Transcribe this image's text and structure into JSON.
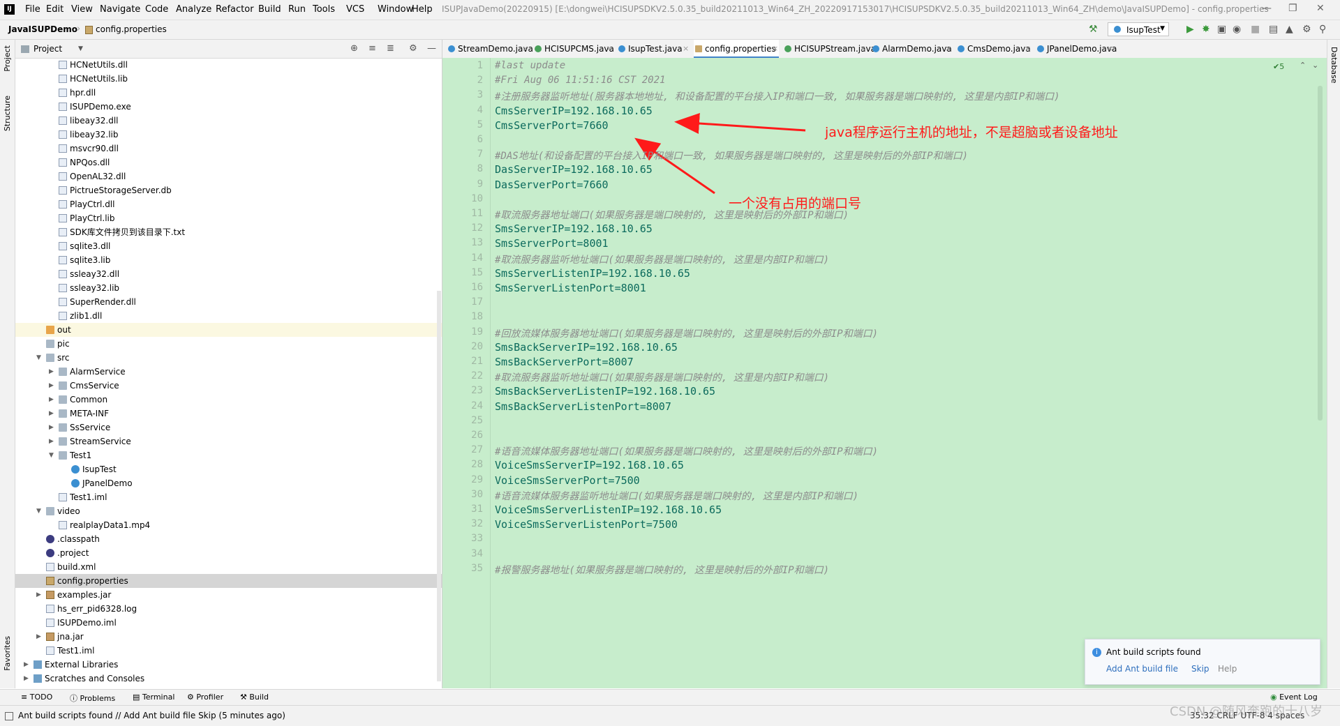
{
  "app": {
    "logo_text": "IJ",
    "window_title": "ISUPJavaDemo(20220915) [E:\\dongwei\\HCISUPSDKV2.5.0.35_build20211013_Win64_ZH_20220917153017\\HCISUPSDKV2.5.0.35_build20211013_Win64_ZH\\demo\\JavaISUPDemo] - config.properties"
  },
  "menu": [
    "File",
    "Edit",
    "View",
    "Navigate",
    "Code",
    "Analyze",
    "Refactor",
    "Build",
    "Run",
    "Tools",
    "VCS",
    "Window",
    "Help"
  ],
  "navbar": {
    "project": "JavaISUPDemo",
    "file": "config.properties",
    "run_config": "IsupTest"
  },
  "left_strip": [
    "Project",
    "Structure",
    "Favorites"
  ],
  "right_strip": [
    "Database"
  ],
  "project_panel": {
    "title": "Project",
    "tree": [
      {
        "label": "HCNetUtils.dll",
        "indent": 2,
        "icon": "file"
      },
      {
        "label": "HCNetUtils.lib",
        "indent": 2,
        "icon": "file"
      },
      {
        "label": "hpr.dll",
        "indent": 2,
        "icon": "file"
      },
      {
        "label": "ISUPDemo.exe",
        "indent": 2,
        "icon": "file"
      },
      {
        "label": "libeay32.dll",
        "indent": 2,
        "icon": "file"
      },
      {
        "label": "libeay32.lib",
        "indent": 2,
        "icon": "file"
      },
      {
        "label": "msvcr90.dll",
        "indent": 2,
        "icon": "file"
      },
      {
        "label": "NPQos.dll",
        "indent": 2,
        "icon": "file"
      },
      {
        "label": "OpenAL32.dll",
        "indent": 2,
        "icon": "file"
      },
      {
        "label": "PictrueStorageServer.db",
        "indent": 2,
        "icon": "file"
      },
      {
        "label": "PlayCtrl.dll",
        "indent": 2,
        "icon": "file"
      },
      {
        "label": "PlayCtrl.lib",
        "indent": 2,
        "icon": "file"
      },
      {
        "label": "SDK库文件拷贝到该目录下.txt",
        "indent": 2,
        "icon": "file"
      },
      {
        "label": "sqlite3.dll",
        "indent": 2,
        "icon": "file"
      },
      {
        "label": "sqlite3.lib",
        "indent": 2,
        "icon": "file"
      },
      {
        "label": "ssleay32.dll",
        "indent": 2,
        "icon": "file"
      },
      {
        "label": "ssleay32.lib",
        "indent": 2,
        "icon": "file"
      },
      {
        "label": "SuperRender.dll",
        "indent": 2,
        "icon": "file"
      },
      {
        "label": "zlib1.dll",
        "indent": 2,
        "icon": "file"
      },
      {
        "label": "out",
        "indent": 1,
        "icon": "folder-o",
        "hl": true
      },
      {
        "label": "pic",
        "indent": 1,
        "icon": "folder"
      },
      {
        "label": "src",
        "indent": 1,
        "icon": "folder",
        "arrow": "down"
      },
      {
        "label": "AlarmService",
        "indent": 2,
        "icon": "folder",
        "arrow": "right"
      },
      {
        "label": "CmsService",
        "indent": 2,
        "icon": "folder",
        "arrow": "right"
      },
      {
        "label": "Common",
        "indent": 2,
        "icon": "folder",
        "arrow": "right"
      },
      {
        "label": "META-INF",
        "indent": 2,
        "icon": "folder",
        "arrow": "right"
      },
      {
        "label": "SsService",
        "indent": 2,
        "icon": "folder",
        "arrow": "right"
      },
      {
        "label": "StreamService",
        "indent": 2,
        "icon": "folder",
        "arrow": "right"
      },
      {
        "label": "Test1",
        "indent": 2,
        "icon": "folder",
        "arrow": "down"
      },
      {
        "label": "IsupTest",
        "indent": 3,
        "icon": "java"
      },
      {
        "label": "JPanelDemo",
        "indent": 3,
        "icon": "java"
      },
      {
        "label": "Test1.iml",
        "indent": 2,
        "icon": "file"
      },
      {
        "label": "video",
        "indent": 1,
        "icon": "folder",
        "arrow": "down"
      },
      {
        "label": "realplayData1.mp4",
        "indent": 2,
        "icon": "file"
      },
      {
        "label": ".classpath",
        "indent": 1,
        "icon": "eclipse"
      },
      {
        "label": ".project",
        "indent": 1,
        "icon": "eclipse"
      },
      {
        "label": "build.xml",
        "indent": 1,
        "icon": "file"
      },
      {
        "label": "config.properties",
        "indent": 1,
        "icon": "cfg",
        "sel": true
      },
      {
        "label": "examples.jar",
        "indent": 1,
        "icon": "jar",
        "arrow": "right"
      },
      {
        "label": "hs_err_pid6328.log",
        "indent": 1,
        "icon": "file"
      },
      {
        "label": "ISUPDemo.iml",
        "indent": 1,
        "icon": "file"
      },
      {
        "label": "jna.jar",
        "indent": 1,
        "icon": "jar",
        "arrow": "right"
      },
      {
        "label": "Test1.iml",
        "indent": 1,
        "icon": "file"
      },
      {
        "label": "External Libraries",
        "indent": 0,
        "icon": "lib",
        "arrow": "right"
      },
      {
        "label": "Scratches and Consoles",
        "indent": 0,
        "icon": "lib",
        "arrow": "right"
      }
    ]
  },
  "tabs": [
    {
      "label": "StreamDemo.java",
      "icon": "java"
    },
    {
      "label": "HCISUPCMS.java",
      "icon": "java-g"
    },
    {
      "label": "IsupTest.java",
      "icon": "java"
    },
    {
      "label": "config.properties",
      "icon": "cfg",
      "active": true
    },
    {
      "label": "HCISUPStream.java",
      "icon": "java-g"
    },
    {
      "label": "AlarmDemo.java",
      "icon": "java"
    },
    {
      "label": "CmsDemo.java",
      "icon": "java"
    },
    {
      "label": "JPanelDemo.java",
      "icon": "java"
    }
  ],
  "editor": {
    "inspection": "✔5",
    "lines": [
      {
        "n": "1",
        "t": "#last update",
        "k": "comment"
      },
      {
        "n": "2",
        "t": "#Fri Aug 06 11:51:16 CST 2021",
        "k": "comment"
      },
      {
        "n": "3",
        "t": "#注册服务器监听地址(服务器本地地址, 和设备配置的平台接入IP和端口一致, 如果服务器是端口映射的, 这里是内部IP和端口)",
        "k": "comment"
      },
      {
        "n": "4",
        "t": "CmsServerIP=192.168.10.65",
        "k": "prop"
      },
      {
        "n": "5",
        "t": "CmsServerPort=7660",
        "k": "prop"
      },
      {
        "n": "6",
        "t": "",
        "k": "prop"
      },
      {
        "n": "7",
        "t": "#DAS地址(和设备配置的平台接入IP和端口一致, 如果服务器是端口映射的, 这里是映射后的外部IP和端口)",
        "k": "comment"
      },
      {
        "n": "8",
        "t": "DasServerIP=192.168.10.65",
        "k": "prop"
      },
      {
        "n": "9",
        "t": "DasServerPort=7660",
        "k": "prop"
      },
      {
        "n": "10",
        "t": "",
        "k": "prop"
      },
      {
        "n": "11",
        "t": "#取流服务器地址端口(如果服务器是端口映射的, 这里是映射后的外部IP和端口)",
        "k": "comment"
      },
      {
        "n": "12",
        "t": "SmsServerIP=192.168.10.65",
        "k": "prop"
      },
      {
        "n": "13",
        "t": "SmsServerPort=8001",
        "k": "prop"
      },
      {
        "n": "14",
        "t": "#取流服务器监听地址端口(如果服务器是端口映射的, 这里是内部IP和端口)",
        "k": "comment"
      },
      {
        "n": "15",
        "t": "SmsServerListenIP=192.168.10.65",
        "k": "prop"
      },
      {
        "n": "16",
        "t": "SmsServerListenPort=8001",
        "k": "prop"
      },
      {
        "n": "17",
        "t": "",
        "k": "prop"
      },
      {
        "n": "18",
        "t": "",
        "k": "prop"
      },
      {
        "n": "19",
        "t": "#回放流媒体服务器地址端口(如果服务器是端口映射的, 这里是映射后的外部IP和端口)",
        "k": "comment"
      },
      {
        "n": "20",
        "t": "SmsBackServerIP=192.168.10.65",
        "k": "prop"
      },
      {
        "n": "21",
        "t": "SmsBackServerPort=8007",
        "k": "prop"
      },
      {
        "n": "22",
        "t": "#取流服务器监听地址端口(如果服务器是端口映射的, 这里是内部IP和端口)",
        "k": "comment"
      },
      {
        "n": "23",
        "t": "SmsBackServerListenIP=192.168.10.65",
        "k": "prop"
      },
      {
        "n": "24",
        "t": "SmsBackServerListenPort=8007",
        "k": "prop"
      },
      {
        "n": "25",
        "t": "",
        "k": "prop"
      },
      {
        "n": "26",
        "t": "",
        "k": "prop"
      },
      {
        "n": "27",
        "t": "#语音流媒体服务器地址端口(如果服务器是端口映射的, 这里是映射后的外部IP和端口)",
        "k": "comment"
      },
      {
        "n": "28",
        "t": "VoiceSmsServerIP=192.168.10.65",
        "k": "prop"
      },
      {
        "n": "29",
        "t": "VoiceSmsServerPort=7500",
        "k": "prop"
      },
      {
        "n": "30",
        "t": "#语音流媒体服务器监听地址端口(如果服务器是端口映射的, 这里是内部IP和端口)",
        "k": "comment"
      },
      {
        "n": "31",
        "t": "VoiceSmsServerListenIP=192.168.10.65",
        "k": "prop"
      },
      {
        "n": "32",
        "t": "VoiceSmsServerListenPort=7500",
        "k": "prop"
      },
      {
        "n": "33",
        "t": "",
        "k": "prop"
      },
      {
        "n": "34",
        "t": "",
        "k": "prop"
      },
      {
        "n": "35",
        "t": "#报警服务器地址(如果服务器是端口映射的, 这里是映射后的外部IP和端口)",
        "k": "comment"
      }
    ]
  },
  "annotations": {
    "ip_note": "java程序运行主机的地址，不是超脑或者设备地址",
    "port_note": "一个没有占用的端口号",
    "color": "#ff1a1a"
  },
  "notification": {
    "title": "Ant build scripts found",
    "link_add": "Add Ant build file",
    "link_skip": "Skip",
    "help": "Help"
  },
  "bottom_tools": [
    "TODO",
    "Problems",
    "Terminal",
    "Profiler",
    "Build",
    "Event Log"
  ],
  "status": {
    "text": "Ant build scripts found // Add Ant build file   Skip (5 minutes ago)",
    "right": "35:32  CRLF  UTF-8  4 spaces"
  },
  "watermark": "CSDN @随风奔跑的十八岁"
}
